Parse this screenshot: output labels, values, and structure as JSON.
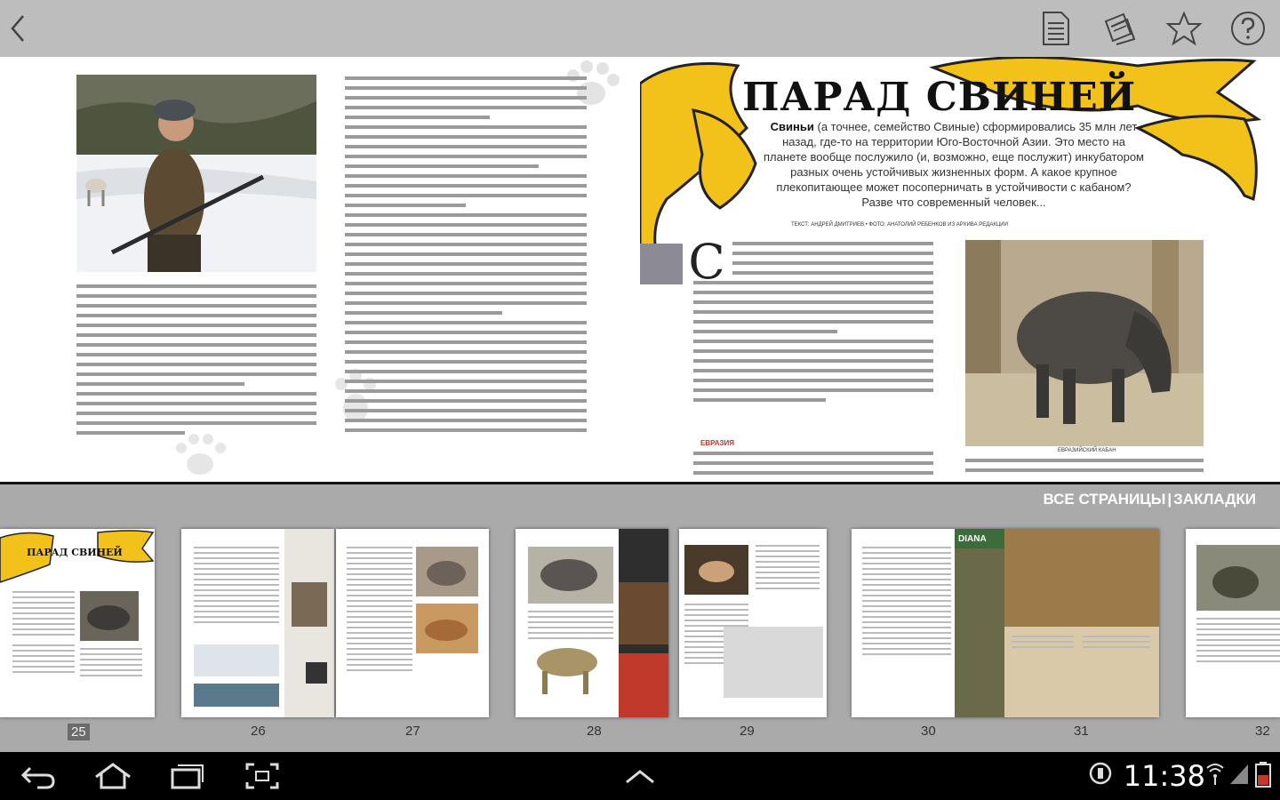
{
  "toolbar": {
    "back_icon": "chevron-left-icon",
    "icons": [
      "page-icon",
      "pages-icon",
      "star-icon",
      "help-icon"
    ]
  },
  "article": {
    "headline": "ПАРАД СВИНЕЙ",
    "lead_bold": "Свиньи",
    "lead_text": "(а точнее, семейство Свиные) сформировались 35 млн лет назад, где-то на территории Юго-Восточной Азии. Это место на планете вообще послужило (и, возможно, еще послужит) инкубатором разных очень устойчивых жизненных форм. А какое крупное плекопитающее может посоперничать в устойчивости с кабаном? Разве что современный человек...",
    "credit": "ТЕКСТ: АНДРЕЙ ДМИТРИЕВ • ФОТО: АНАТОЛИЙ РЕБЕНКОВ ИЗ АРХИВА РЕДАКЦИИ",
    "dropcap": "С",
    "subhead": "ЕВРАЗИЯ",
    "boar_caption": "ЕВРАЗИЙСКИЙ КАБАН"
  },
  "strip": {
    "tab_all": "ВСЕ СТРАНИЦЫ",
    "separator": "|",
    "tab_bookmarks": "ЗАКЛАДКИ",
    "thumb_title": "ПАРАД СВИНЕЙ",
    "diana_logo": "DIANA",
    "pages": [
      "25",
      "26",
      "27",
      "28",
      "29",
      "30",
      "31",
      "32"
    ],
    "active_page": "25"
  },
  "status": {
    "time": "11:38"
  },
  "navbar": {
    "icons": [
      "back-icon",
      "home-icon",
      "recent-apps-icon",
      "screenshot-icon",
      "up-chevron-icon"
    ]
  }
}
